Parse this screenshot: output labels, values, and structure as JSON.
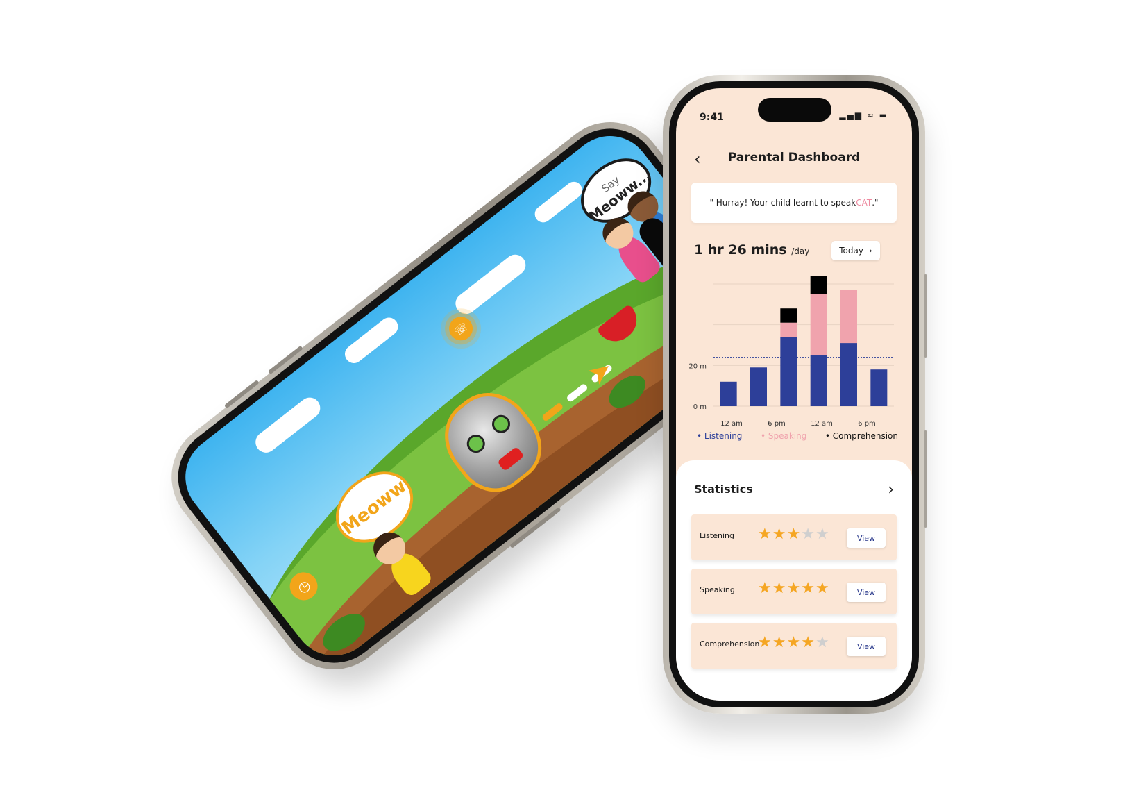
{
  "game": {
    "bubble_right_small": "Say",
    "bubble_right_big": "Meoww...",
    "bubble_left": "Meoww",
    "sound_icon": "speaker-waves-icon",
    "clock_icon": "clock-icon",
    "accent_color": "#f2a51a"
  },
  "status": {
    "time": "9:41",
    "icons": "signal-wifi-battery"
  },
  "header": {
    "title": "Parental Dashboard",
    "back_icon": "chevron-left-icon"
  },
  "notice": {
    "prefix": "\" Hurray! Your child learnt to speak ",
    "highlight": "CAT",
    "suffix": ".\""
  },
  "usage": {
    "duration": "1 hr 26 mins",
    "unit": "/day",
    "period_button": "Today",
    "period_icon": "chevron-right-icon"
  },
  "chart_data": {
    "type": "bar",
    "stacked": true,
    "x_tick_labels": [
      "12 am",
      "6 pm",
      "12 am",
      "6 pm"
    ],
    "y_tick_labels": [
      "0 m",
      "20 m",
      "",
      ""
    ],
    "ylim": [
      0,
      60
    ],
    "grid": true,
    "reference_line": 24,
    "legend_position": "bottom",
    "bars": [
      {
        "x": 0,
        "listening": 12,
        "speaking": 0,
        "comprehension": 0
      },
      {
        "x": 1,
        "listening": 19,
        "speaking": 0,
        "comprehension": 0
      },
      {
        "x": 2,
        "listening": 34,
        "speaking": 7,
        "comprehension": 7
      },
      {
        "x": 3,
        "listening": 25,
        "speaking": 30,
        "comprehension": 9
      },
      {
        "x": 4,
        "listening": 31,
        "speaking": 26,
        "comprehension": 0
      },
      {
        "x": 5,
        "listening": 18,
        "speaking": 0,
        "comprehension": 0
      }
    ],
    "series": [
      {
        "name": "Listening",
        "color": "#2d3f99"
      },
      {
        "name": "Speaking",
        "color": "#f0a3ad"
      },
      {
        "name": "Comprehension",
        "color": "#000000"
      }
    ]
  },
  "legend": {
    "listening": "Listening",
    "speaking": "Speaking",
    "comprehension": "Comprehension"
  },
  "statistics": {
    "title": "Statistics",
    "rows": [
      {
        "label": "Listening",
        "rating": 3,
        "max": 5,
        "button": "View"
      },
      {
        "label": "Speaking",
        "rating": 5,
        "max": 5,
        "button": "View"
      },
      {
        "label": "Comprehension",
        "rating": 4,
        "max": 5,
        "button": "View"
      }
    ]
  }
}
